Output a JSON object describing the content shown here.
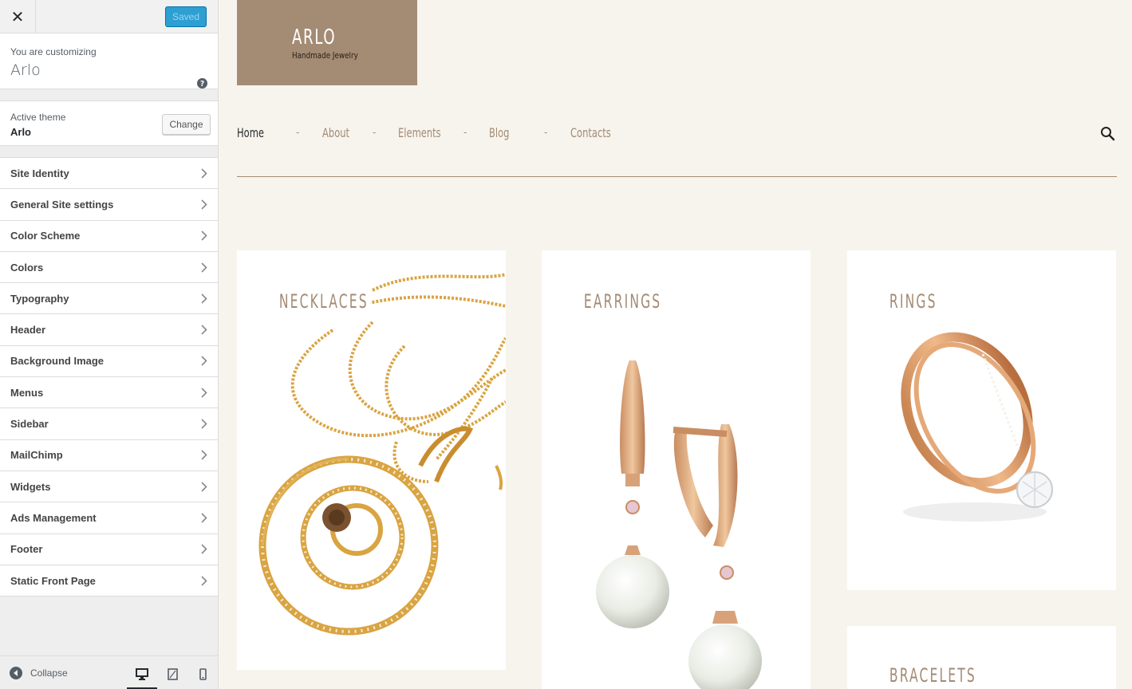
{
  "customizer": {
    "close_icon": "close-icon",
    "saved_label": "Saved",
    "intro_pre": "You are customizing",
    "site_name": "Arlo",
    "help_icon": "question-circle-icon",
    "active_theme_label": "Active theme",
    "theme_name": "Arlo",
    "change_label": "Change",
    "sections": [
      {
        "label": "Site Identity"
      },
      {
        "label": "General Site settings"
      },
      {
        "label": "Color Scheme"
      },
      {
        "label": "Colors"
      },
      {
        "label": "Typography"
      },
      {
        "label": "Header"
      },
      {
        "label": "Background Image"
      },
      {
        "label": "Menus"
      },
      {
        "label": "Sidebar"
      },
      {
        "label": "MailChimp"
      },
      {
        "label": "Widgets"
      },
      {
        "label": "Ads Management"
      },
      {
        "label": "Footer"
      },
      {
        "label": "Static Front Page"
      }
    ],
    "collapse_label": "Collapse",
    "devices": [
      "desktop-icon",
      "tablet-icon",
      "mobile-icon"
    ],
    "active_device": "desktop"
  },
  "preview": {
    "logo_title": "ARLO",
    "logo_subtitle": "Handmade Jewelry",
    "nav": [
      {
        "label": "Home",
        "active": true
      },
      {
        "label": "About",
        "active": false
      },
      {
        "label": "Elements",
        "active": false
      },
      {
        "label": "Blog",
        "active": false
      },
      {
        "label": "Contacts",
        "active": false
      }
    ],
    "nav_separator": "-",
    "search_icon": "search-icon",
    "categories": [
      {
        "label": "NECKLACES"
      },
      {
        "label": "EARRINGS"
      },
      {
        "label": "RINGS"
      },
      {
        "label": "BRACELETS"
      }
    ]
  },
  "colors": {
    "accent": "#a38b74",
    "background": "#f7f4ee",
    "button_primary": "#2e9fd2",
    "gold": "#d9a441"
  }
}
